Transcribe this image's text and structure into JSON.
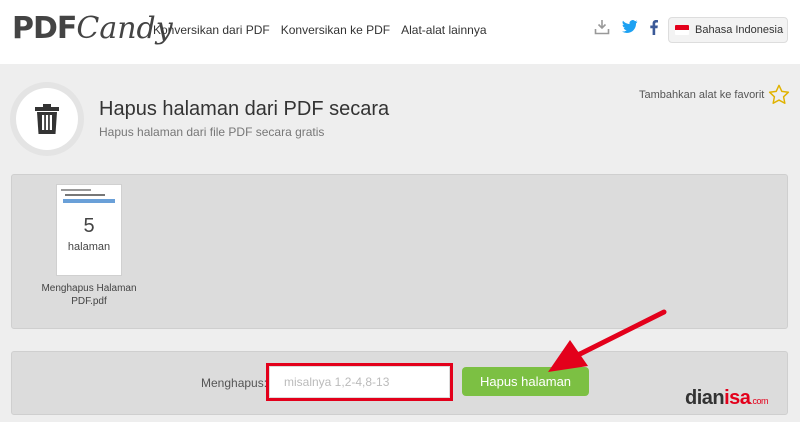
{
  "header": {
    "logo_left": "PDF",
    "logo_right": "Candy",
    "nav": [
      {
        "label": "Konversikan dari PDF"
      },
      {
        "label": "Konversikan ke PDF"
      },
      {
        "label": "Alat-alat lainnya"
      }
    ],
    "language": "Bahasa Indonesia"
  },
  "tool": {
    "title": "Hapus halaman dari PDF secara",
    "subtitle": "Hapus halaman dari file PDF secara gratis",
    "favorite_label": "Tambahkan alat ke favorit"
  },
  "file": {
    "page_count": "5",
    "page_unit": "halaman",
    "name": "Menghapus Halaman PDF.pdf"
  },
  "action": {
    "label": "Menghapus:",
    "placeholder": "misalnya 1,2-4,8-13",
    "button": "Hapus halaman"
  },
  "watermark": {
    "main_a": "dian",
    "main_b": "isa",
    "domain": ".com"
  },
  "colors": {
    "accent_green": "#7cc043",
    "highlight_red": "#e3001b",
    "twitter_blue": "#1da1f2",
    "facebook_blue": "#3b5998"
  }
}
